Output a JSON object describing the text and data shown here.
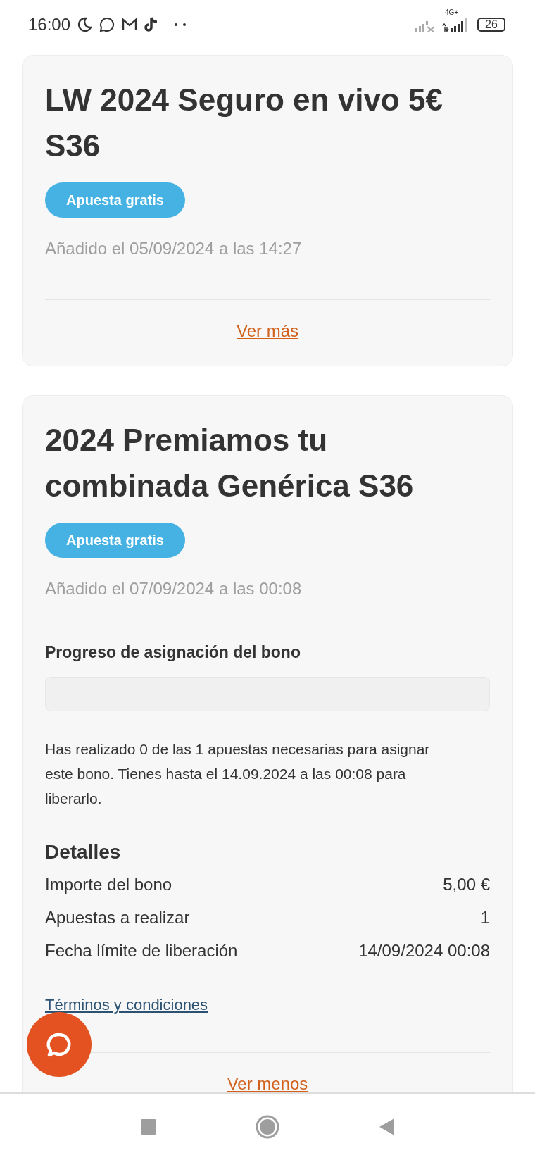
{
  "status_bar": {
    "time": "16:00",
    "network_type": "4G+",
    "battery": "26"
  },
  "cards": [
    {
      "title": "LW 2024 Seguro en vivo 5€ S36",
      "badge": "Apuesta gratis",
      "added": "Añadido el 05/09/2024 a las 14:27",
      "toggle": "Ver más"
    },
    {
      "title": "2024 Premiamos tu combinada Genérica S36",
      "badge": "Apuesta gratis",
      "added": "Añadido el 07/09/2024 a las 00:08",
      "progress": {
        "label": "Progreso de asignación del bono",
        "level": 0
      },
      "message": "Has realizado 0 de las 1 apuestas necesarias para asignar este bono. Tienes hasta el 14.09.2024 a las 00:08 para liberarlo.",
      "details": {
        "title": "Detalles",
        "rows": [
          {
            "label": "Importe del bono",
            "value": "5,00 €"
          },
          {
            "label": "Apuestas a realizar",
            "value": "1"
          },
          {
            "label": "Fecha límite de liberación",
            "value": "14/09/2024 00:08"
          }
        ]
      },
      "terms": "Términos y condiciones",
      "toggle": "Ver menos"
    }
  ]
}
